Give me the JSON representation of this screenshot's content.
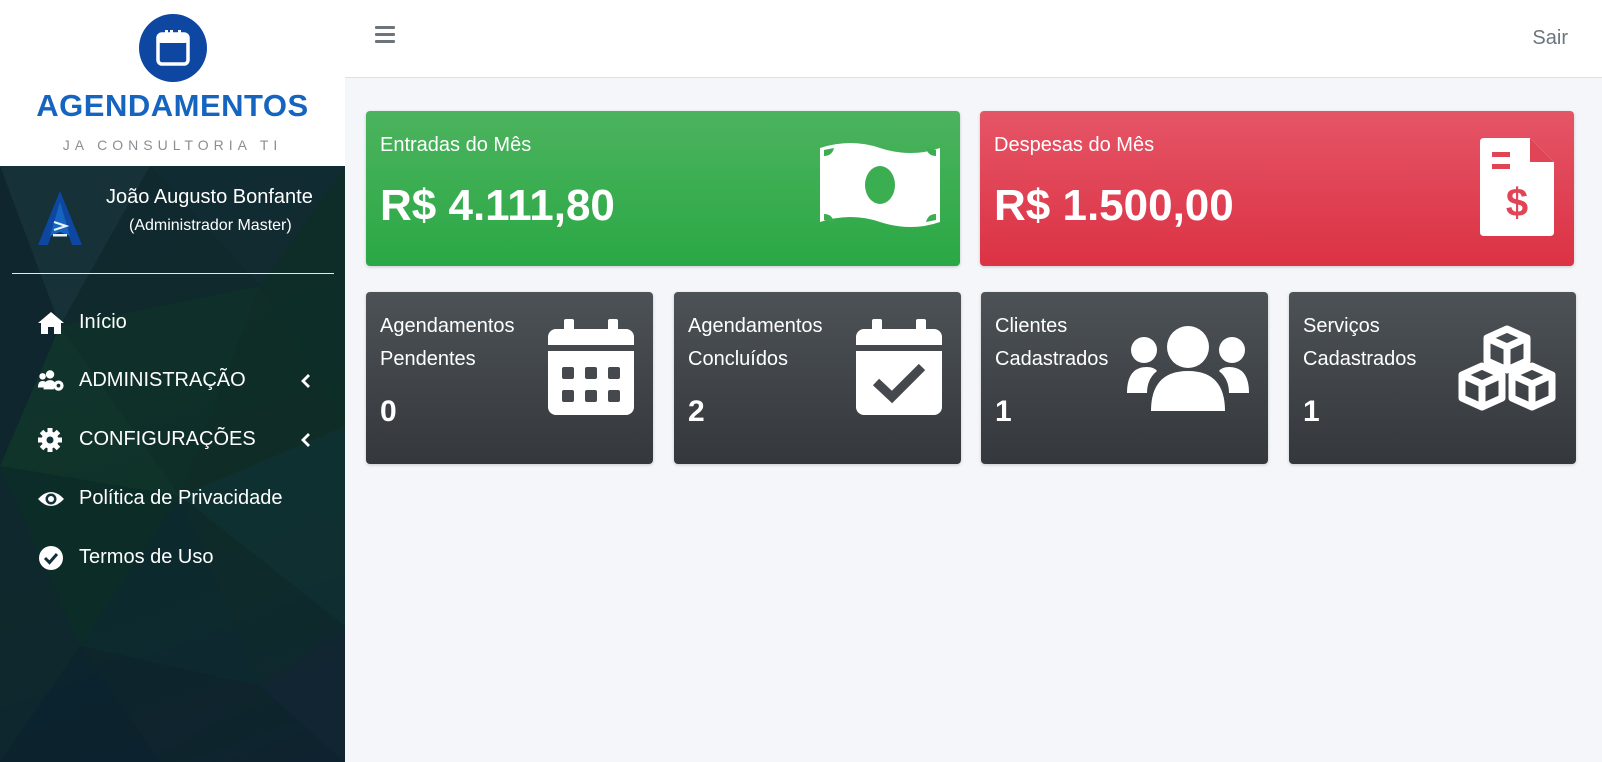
{
  "brand": {
    "title": "AGENDAMENTOS",
    "subtitle": "JA CONSULTORIA TI",
    "logo_icon": "calendar-icon",
    "color": "#1565c0"
  },
  "user": {
    "name": "João Augusto Bonfante",
    "role": "(Administrador Master)",
    "avatar_icon": "ja-logo-avatar"
  },
  "sidebar": {
    "items": [
      {
        "label": "Início",
        "icon": "home-icon"
      },
      {
        "label": "ADMINISTRAÇÃO",
        "icon": "users-cog-icon",
        "has_submenu": true
      },
      {
        "label": "CONFIGURAÇÕES",
        "icon": "gear-icon",
        "has_submenu": true
      },
      {
        "label": "Política de Privacidade",
        "icon": "eye-icon"
      },
      {
        "label": "Termos de Uso",
        "icon": "check-circle-icon"
      }
    ]
  },
  "topbar": {
    "menu_icon": "hamburger-icon",
    "logout_label": "Sair"
  },
  "summary": {
    "income": {
      "title": "Entradas do Mês",
      "value": "R$ 4.111,80",
      "icon": "money-bill-icon",
      "color": "#28a745"
    },
    "expenses": {
      "title": "Despesas do Mês",
      "value": "R$ 1.500,00",
      "icon": "invoice-dollar-icon",
      "color": "#dc3545"
    }
  },
  "stats": [
    {
      "title_line1": "Agendamentos",
      "title_line2": "Pendentes",
      "value": "0",
      "icon": "calendar-grid-icon"
    },
    {
      "title_line1": "Agendamentos",
      "title_line2": "Concluídos",
      "value": "2",
      "icon": "calendar-check-icon"
    },
    {
      "title_line1": "Clientes",
      "title_line2": "Cadastrados",
      "value": "1",
      "icon": "users-icon"
    },
    {
      "title_line1": "Serviços",
      "title_line2": "Cadastrados",
      "value": "1",
      "icon": "cubes-icon"
    }
  ]
}
